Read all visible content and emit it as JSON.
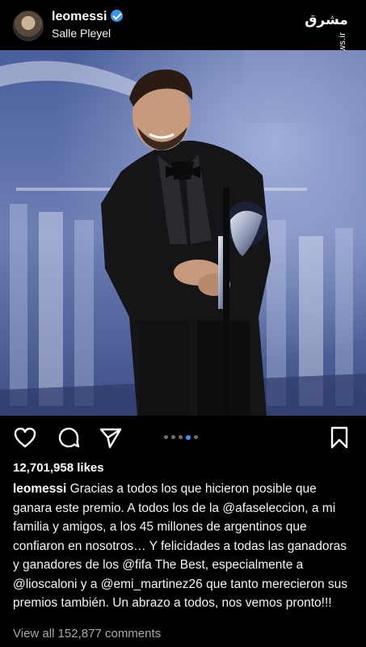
{
  "header": {
    "username": "leomessi",
    "location": "Salle Pleyel",
    "watermark_logo": "مشرق",
    "watermark_url": "mashreghnews.ir"
  },
  "post": {
    "carousel_count": 5,
    "carousel_active_index": 3
  },
  "actions": {
    "like_icon": "heart-icon",
    "comment_icon": "comment-icon",
    "share_icon": "send-icon",
    "save_icon": "bookmark-icon"
  },
  "likes": "12,701,958 likes",
  "caption": {
    "username": "leomessi",
    "text": "Gracias a todos los que hicieron posible que ganara este premio. A todos los de la @afaseleccion, a mi familia y amigos, a los 45 millones de argentinos que confiaron en nosotros… Y felicidades a todas las ganadoras y ganadores de los @fifa The Best, especialmente a @lioscaloni y a @emi_martinez26 que tanto merecieron sus premios también. Un abrazo a todos, nos vemos pronto!!!"
  },
  "comments_link": "View all 152,877 comments",
  "colors": {
    "background": "#000000",
    "verified": "#3897f0",
    "dot_active": "#3897f0",
    "secondary_text": "#a8a8a8"
  }
}
